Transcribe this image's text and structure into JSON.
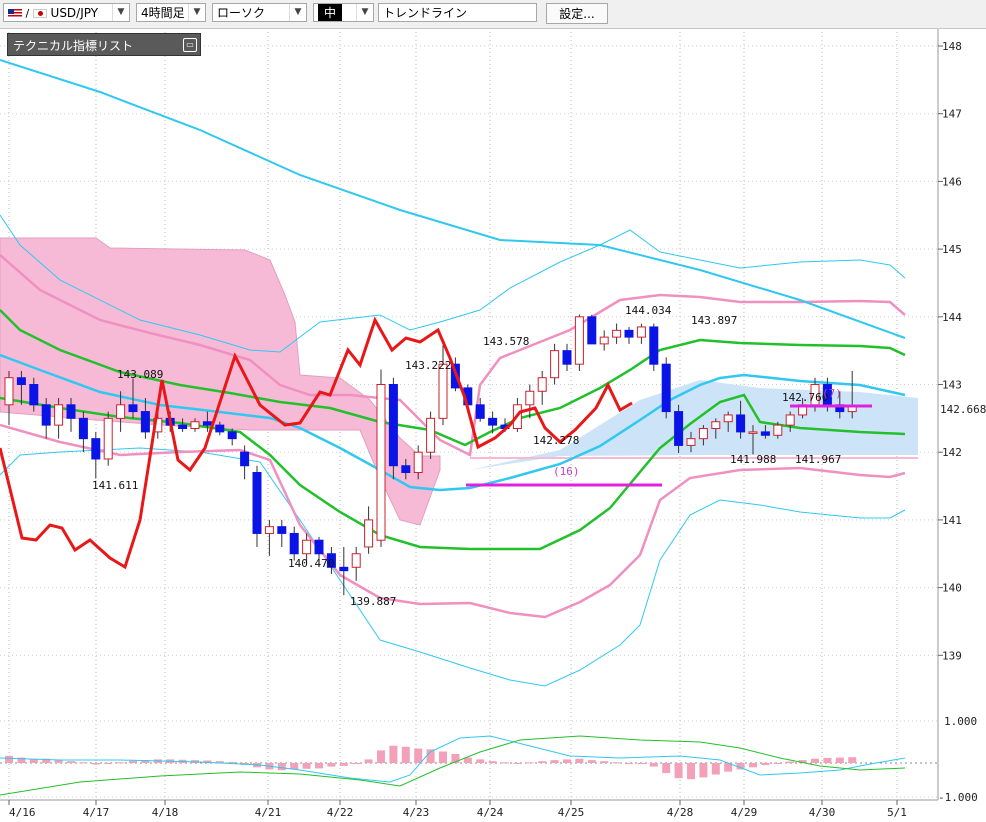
{
  "toolbar": {
    "symbol": "USD/JPY",
    "timeframe": "4時間足",
    "chart_style": "ローソク",
    "line_width": "中",
    "drawing_tool": "トレンドライン",
    "settings_label": "設定..."
  },
  "indicator_panel": {
    "label": "テクニカル指標リスト"
  },
  "colors": {
    "bull": "#d02030",
    "bear": "#0a14e6",
    "ma_fast": "#22c02a",
    "ma_slow": "#30c8f0",
    "bb": "#f090c0",
    "cloud": "#f7bad6",
    "cloud2": "#cde4f8",
    "osc": "#e81818",
    "trend": "#e020e0"
  },
  "chart_data": {
    "type": "line",
    "title": "",
    "xlabel": "",
    "ylabel": "",
    "ylim": [
      138.2,
      148.3
    ],
    "yticks": [
      148,
      147,
      146,
      145,
      144,
      143,
      142,
      141,
      140,
      139
    ],
    "xticks": [
      "4/16",
      "4/17",
      "4/18",
      "4/21",
      "4/22",
      "4/23",
      "4/24",
      "4/25",
      "4/28",
      "4/29",
      "4/30",
      "5/1"
    ],
    "current_price": "142.668",
    "series": [
      {
        "values": [
          {
            "o": 142.7,
            "h": 143.2,
            "l": 142.4,
            "c": 143.1
          },
          {
            "o": 143.1,
            "h": 143.2,
            "l": 142.7,
            "c": 143.0
          },
          {
            "o": 143.0,
            "h": 143.1,
            "l": 142.6,
            "c": 142.7
          },
          {
            "o": 142.7,
            "h": 142.8,
            "l": 142.2,
            "c": 142.4
          },
          {
            "o": 142.4,
            "h": 142.8,
            "l": 142.2,
            "c": 142.7
          },
          {
            "o": 142.7,
            "h": 142.8,
            "l": 142.3,
            "c": 142.5
          },
          {
            "o": 142.5,
            "h": 142.6,
            "l": 142.0,
            "c": 142.2
          },
          {
            "o": 142.2,
            "h": 142.3,
            "l": 141.611,
            "c": 141.9
          },
          {
            "o": 141.9,
            "h": 142.6,
            "l": 141.8,
            "c": 142.5
          },
          {
            "o": 142.5,
            "h": 142.9,
            "l": 142.3,
            "c": 142.7
          },
          {
            "o": 142.7,
            "h": 143.089,
            "l": 142.5,
            "c": 142.6
          },
          {
            "o": 142.6,
            "h": 142.8,
            "l": 142.2,
            "c": 142.3
          },
          {
            "o": 142.3,
            "h": 142.7,
            "l": 142.2,
            "c": 142.5
          },
          {
            "o": 142.5,
            "h": 142.6,
            "l": 142.3,
            "c": 142.4
          },
          {
            "o": 142.4,
            "h": 142.5,
            "l": 142.3,
            "c": 142.35
          },
          {
            "o": 142.35,
            "h": 142.5,
            "l": 142.3,
            "c": 142.45
          },
          {
            "o": 142.45,
            "h": 142.6,
            "l": 142.3,
            "c": 142.4
          },
          {
            "o": 142.4,
            "h": 142.45,
            "l": 142.25,
            "c": 142.3
          },
          {
            "o": 142.3,
            "h": 142.35,
            "l": 142.1,
            "c": 142.2
          },
          {
            "o": 142.0,
            "h": 142.1,
            "l": 141.6,
            "c": 141.8
          },
          {
            "o": 141.7,
            "h": 141.8,
            "l": 140.6,
            "c": 140.8
          },
          {
            "o": 140.8,
            "h": 141.0,
            "l": 140.47,
            "c": 140.9
          },
          {
            "o": 140.9,
            "h": 141.0,
            "l": 140.6,
            "c": 140.8
          },
          {
            "o": 140.8,
            "h": 140.9,
            "l": 140.4,
            "c": 140.5
          },
          {
            "o": 140.5,
            "h": 140.8,
            "l": 140.4,
            "c": 140.7
          },
          {
            "o": 140.7,
            "h": 140.75,
            "l": 140.4,
            "c": 140.5
          },
          {
            "o": 140.5,
            "h": 140.6,
            "l": 140.2,
            "c": 140.3
          },
          {
            "o": 140.3,
            "h": 140.6,
            "l": 139.887,
            "c": 140.25
          },
          {
            "o": 140.3,
            "h": 140.6,
            "l": 140.1,
            "c": 140.5
          },
          {
            "o": 140.6,
            "h": 141.2,
            "l": 140.5,
            "c": 141.0
          },
          {
            "o": 140.7,
            "h": 143.222,
            "l": 140.6,
            "c": 143.0
          },
          {
            "o": 143.0,
            "h": 143.1,
            "l": 141.6,
            "c": 141.8
          },
          {
            "o": 141.8,
            "h": 141.9,
            "l": 141.6,
            "c": 141.7
          },
          {
            "o": 141.7,
            "h": 142.1,
            "l": 141.6,
            "c": 142.0
          },
          {
            "o": 142.0,
            "h": 142.6,
            "l": 141.9,
            "c": 142.5
          },
          {
            "o": 142.5,
            "h": 143.578,
            "l": 142.4,
            "c": 143.3
          },
          {
            "o": 143.3,
            "h": 143.4,
            "l": 142.9,
            "c": 142.95
          },
          {
            "o": 142.95,
            "h": 143.0,
            "l": 142.6,
            "c": 142.7
          },
          {
            "o": 142.7,
            "h": 142.8,
            "l": 142.45,
            "c": 142.5
          },
          {
            "o": 142.5,
            "h": 142.6,
            "l": 142.278,
            "c": 142.4
          },
          {
            "o": 142.4,
            "h": 142.5,
            "l": 142.3,
            "c": 142.35
          },
          {
            "o": 142.35,
            "h": 142.8,
            "l": 142.3,
            "c": 142.7
          },
          {
            "o": 142.7,
            "h": 143.0,
            "l": 142.5,
            "c": 142.9
          },
          {
            "o": 142.9,
            "h": 143.2,
            "l": 142.7,
            "c": 143.1
          },
          {
            "o": 143.1,
            "h": 143.6,
            "l": 143.0,
            "c": 143.5
          },
          {
            "o": 143.5,
            "h": 143.6,
            "l": 143.2,
            "c": 143.3
          },
          {
            "o": 143.3,
            "h": 144.034,
            "l": 143.2,
            "c": 144.0
          },
          {
            "o": 144.0,
            "h": 144.03,
            "l": 143.6,
            "c": 143.6
          },
          {
            "o": 143.6,
            "h": 143.8,
            "l": 143.5,
            "c": 143.7
          },
          {
            "o": 143.7,
            "h": 143.9,
            "l": 143.6,
            "c": 143.8
          },
          {
            "o": 143.8,
            "h": 143.85,
            "l": 143.6,
            "c": 143.7
          },
          {
            "o": 143.7,
            "h": 143.897,
            "l": 143.6,
            "c": 143.85
          },
          {
            "o": 143.85,
            "h": 143.9,
            "l": 143.2,
            "c": 143.3
          },
          {
            "o": 143.3,
            "h": 143.4,
            "l": 142.5,
            "c": 142.6
          },
          {
            "o": 142.6,
            "h": 142.7,
            "l": 141.988,
            "c": 142.1
          },
          {
            "o": 142.1,
            "h": 142.3,
            "l": 142.0,
            "c": 142.2
          },
          {
            "o": 142.2,
            "h": 142.4,
            "l": 142.1,
            "c": 142.35
          },
          {
            "o": 142.35,
            "h": 142.5,
            "l": 142.2,
            "c": 142.45
          },
          {
            "o": 142.45,
            "h": 142.6,
            "l": 142.3,
            "c": 142.55
          },
          {
            "o": 142.55,
            "h": 142.76,
            "l": 142.2,
            "c": 142.3
          },
          {
            "o": 142.3,
            "h": 142.4,
            "l": 141.967,
            "c": 142.3
          },
          {
            "o": 142.3,
            "h": 142.4,
            "l": 142.2,
            "c": 142.25
          },
          {
            "o": 142.25,
            "h": 142.45,
            "l": 142.2,
            "c": 142.4
          },
          {
            "o": 142.4,
            "h": 142.6,
            "l": 142.3,
            "c": 142.55
          },
          {
            "o": 142.55,
            "h": 142.8,
            "l": 142.5,
            "c": 142.7
          },
          {
            "o": 142.7,
            "h": 143.1,
            "l": 142.6,
            "c": 143.0
          },
          {
            "o": 143.0,
            "h": 143.1,
            "l": 142.6,
            "c": 142.7
          },
          {
            "o": 142.7,
            "h": 142.9,
            "l": 142.5,
            "c": 142.6
          },
          {
            "o": 142.6,
            "h": 143.2,
            "l": 142.5,
            "c": 142.668
          }
        ]
      }
    ],
    "annotations": [
      {
        "label": "143.089"
      },
      {
        "label": "141.611"
      },
      {
        "label": "140.470"
      },
      {
        "label": "139.887"
      },
      {
        "label": "143.222"
      },
      {
        "label": "143.578"
      },
      {
        "label": "142.278"
      },
      {
        "label": "144.034"
      },
      {
        "label": "143.897"
      },
      {
        "label": "141.988"
      },
      {
        "label": "141.967"
      },
      {
        "label": "142.760"
      },
      {
        "label": "(16)"
      },
      {
        "label": "(7)"
      }
    ],
    "oscillator": {
      "yticks": [
        "1.000",
        "-1.000"
      ]
    }
  }
}
